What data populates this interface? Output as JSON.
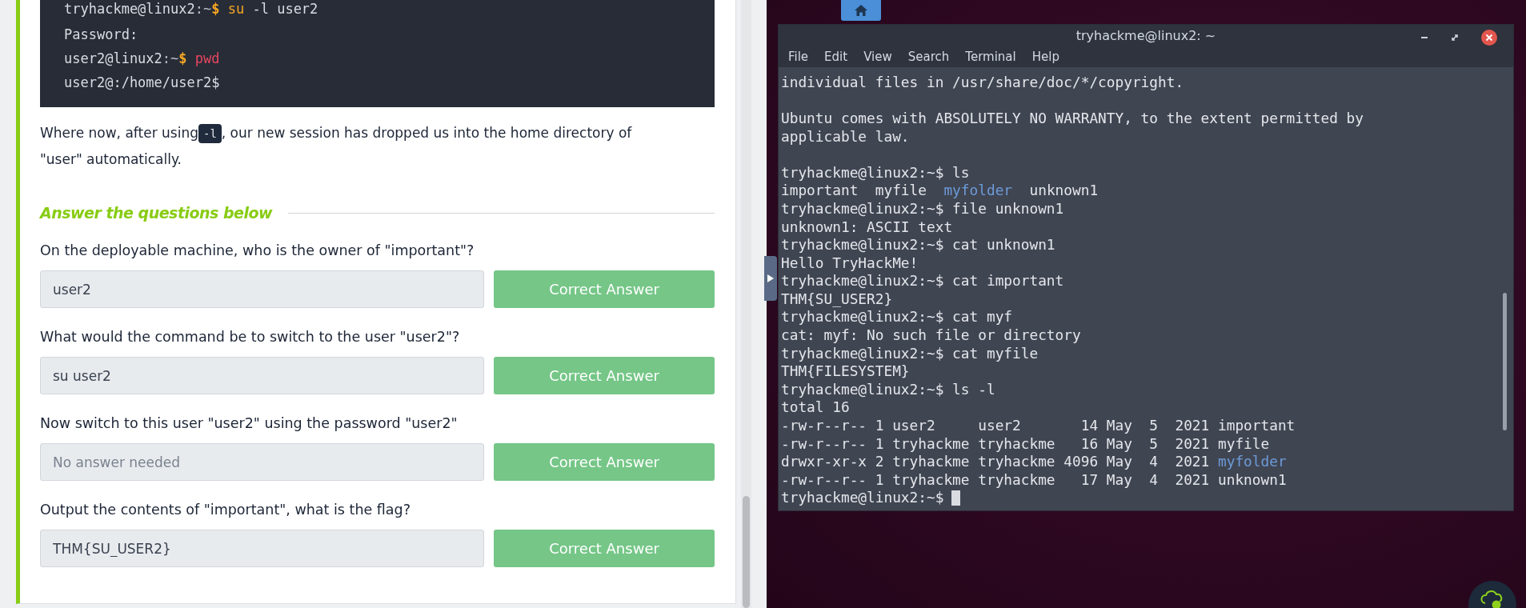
{
  "code_block": {
    "lines": [
      [
        {
          "text": "tryhackme@linux2",
          "kind": "plain"
        },
        {
          "text": ":~",
          "kind": "dim"
        },
        {
          "text": "$",
          "kind": "prompt"
        },
        {
          "text": " su",
          "kind": "keyword"
        },
        {
          "text": " -l user2",
          "kind": "plain"
        }
      ],
      [
        {
          "text": "Password:",
          "kind": "plain"
        }
      ],
      [
        {
          "text": "user2@linux2",
          "kind": "plain"
        },
        {
          "text": ":~",
          "kind": "dim"
        },
        {
          "text": "$",
          "kind": "prompt"
        },
        {
          "text": " pwd",
          "kind": "command"
        }
      ],
      [
        {
          "text": "user2@:/home/user2$",
          "kind": "plain"
        }
      ]
    ]
  },
  "paragraph": {
    "before": "Where now, after using",
    "code": "-l",
    "after": ", our new session has dropped us into the home directory of",
    "continued": "\"user\" automatically."
  },
  "questions_heading": "Answer the questions below",
  "questions": [
    {
      "question": "On the deployable machine, who is the owner of \"important\"?",
      "value": "user2",
      "button": "Correct Answer"
    },
    {
      "question": "What would the command be to switch to the user \"user2\"?",
      "value": "su user2",
      "button": "Correct Answer"
    },
    {
      "question": "Now switch to this user \"user2\" using the password \"user2\"",
      "placeholder": "No answer needed",
      "button": "Correct Answer"
    },
    {
      "question": "Output the contents of \"important\", what is the flag?",
      "value": "THM{SU_USER2}",
      "button": "Correct Answer"
    }
  ],
  "terminal": {
    "title": "tryhackme@linux2: ~",
    "menu": [
      "File",
      "Edit",
      "View",
      "Search",
      "Terminal",
      "Help"
    ],
    "cursor_visible": true,
    "lines": [
      [
        {
          "text": "individual files in /usr/share/doc/*/copyright.",
          "kind": "plain"
        }
      ],
      [
        {
          "kind": "blank"
        }
      ],
      [
        {
          "text": "Ubuntu comes with ABSOLUTELY NO WARRANTY, to the extent permitted by",
          "kind": "plain"
        }
      ],
      [
        {
          "text": "applicable law.",
          "kind": "plain"
        }
      ],
      [
        {
          "kind": "blank"
        }
      ],
      [
        {
          "text": "tryhackme@linux2:~$ ls",
          "kind": "plain"
        }
      ],
      [
        {
          "text": "important  myfile  ",
          "kind": "plain"
        },
        {
          "text": "myfolder",
          "kind": "dir"
        },
        {
          "text": "  unknown1",
          "kind": "plain"
        }
      ],
      [
        {
          "text": "tryhackme@linux2:~$ file unknown1",
          "kind": "plain"
        }
      ],
      [
        {
          "text": "unknown1: ASCII text",
          "kind": "plain"
        }
      ],
      [
        {
          "text": "tryhackme@linux2:~$ cat unknown1",
          "kind": "plain"
        }
      ],
      [
        {
          "text": "Hello TryHackMe!",
          "kind": "plain"
        }
      ],
      [
        {
          "text": "tryhackme@linux2:~$ cat important",
          "kind": "plain"
        }
      ],
      [
        {
          "text": "THM{SU_USER2}",
          "kind": "plain"
        }
      ],
      [
        {
          "text": "tryhackme@linux2:~$ cat myf",
          "kind": "plain"
        }
      ],
      [
        {
          "text": "cat: myf: No such file or directory",
          "kind": "plain"
        }
      ],
      [
        {
          "text": "tryhackme@linux2:~$ cat myfile",
          "kind": "plain"
        }
      ],
      [
        {
          "text": "THM{FILESYSTEM}",
          "kind": "plain"
        }
      ],
      [
        {
          "text": "tryhackme@linux2:~$ ls -l",
          "kind": "plain"
        }
      ],
      [
        {
          "text": "total 16",
          "kind": "plain"
        }
      ],
      [
        {
          "text": "-rw-r--r-- 1 user2     user2       14 May  5  2021 important",
          "kind": "plain"
        }
      ],
      [
        {
          "text": "-rw-r--r-- 1 tryhackme tryhackme   16 May  5  2021 myfile",
          "kind": "plain"
        }
      ],
      [
        {
          "text": "drwxr-xr-x 2 tryhackme tryhackme 4096 May  4  2021 ",
          "kind": "plain"
        },
        {
          "text": "myfolder",
          "kind": "dir"
        }
      ],
      [
        {
          "text": "-rw-r--r-- 1 tryhackme tryhackme   17 May  4  2021 unknown1",
          "kind": "plain"
        }
      ],
      [
        {
          "text": "tryhackme@linux2:~$",
          "kind": "plain"
        }
      ]
    ]
  }
}
